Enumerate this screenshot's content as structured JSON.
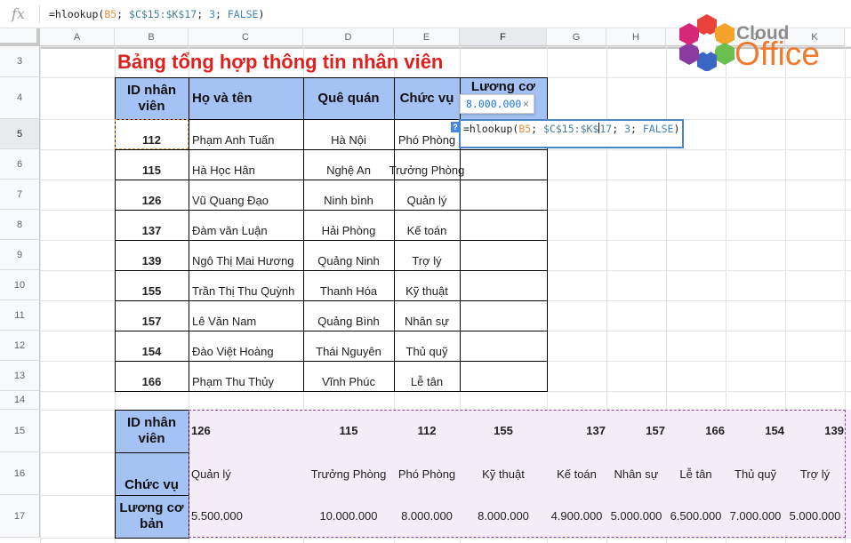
{
  "formula_bar": {
    "icon": "fx-icon",
    "text": "=hlookup(B5; $C$15:$K$17; 3; FALSE)",
    "parts": [
      "=hlookup(",
      "B5",
      "; ",
      "$C$15:$K$17",
      "; ",
      "3",
      "; ",
      "FALSE",
      ")"
    ]
  },
  "logo": {
    "line1": "Cloud",
    "line2": "Office"
  },
  "columns": [
    "A",
    "B",
    "C",
    "D",
    "E",
    "F",
    "G",
    "H",
    "I",
    "J",
    "K"
  ],
  "rows": [
    "3",
    "4",
    "5",
    "6",
    "7",
    "8",
    "9",
    "10",
    "11",
    "12",
    "13",
    "14",
    "15",
    "16",
    "17"
  ],
  "title": "Bảng tổng hợp thông tin nhân viên",
  "table1": {
    "headers": [
      "ID nhân viên",
      "Họ và tên",
      "Quê quán",
      "Chức vụ",
      "Lương cơ"
    ],
    "rows": [
      [
        "112",
        "Phạm Anh Tuấn",
        "Hà Nội",
        "Phó Phòng"
      ],
      [
        "115",
        "Hà Học Hân",
        "Nghệ An",
        "Trưởng Phòng"
      ],
      [
        "126",
        "Vũ Quang Đạo",
        "Ninh bình",
        "Quản lý"
      ],
      [
        "137",
        "Đàm văn Luận",
        "Hải Phòng",
        "Kế toán"
      ],
      [
        "139",
        "Ngô Thị Mai Hương",
        "Quảng Ninh",
        "Trợ lý"
      ],
      [
        "155",
        "Trần Thị Thu Quỳnh",
        "Thanh Hóa",
        "Kỹ thuật"
      ],
      [
        "157",
        "Lê Văn Nam",
        "Quảng Bình",
        "Nhân sự"
      ],
      [
        "154",
        "Đào Việt Hoàng",
        "Thái Nguyên",
        "Thủ quỹ"
      ],
      [
        "166",
        "Phạm Thu Thủy",
        "Vĩnh Phúc",
        "Lễ tân"
      ]
    ]
  },
  "table2": {
    "headers": [
      "ID nhân viên",
      "Chức vụ",
      "Lương cơ bản"
    ],
    "ids": [
      "126",
      "115",
      "112",
      "155",
      "137",
      "157",
      "166",
      "154",
      "139"
    ],
    "positions": [
      "Quản lý",
      "Trưởng Phòng",
      "Phó Phòng",
      "Kỹ thuật",
      "Kế toán",
      "Nhân sự",
      "Lễ tân",
      "Thủ quỹ",
      "Trợ lý"
    ],
    "salaries": [
      "5.500.000",
      "10.000.000",
      "8.000.000",
      "8.000.000",
      "4.900.000",
      "5.000.000",
      "6.500.000",
      "7.000.000",
      "5.000.000"
    ]
  },
  "edit": {
    "tooltip_value": "8.000.000",
    "tooltip_close": "×",
    "help": "?"
  }
}
